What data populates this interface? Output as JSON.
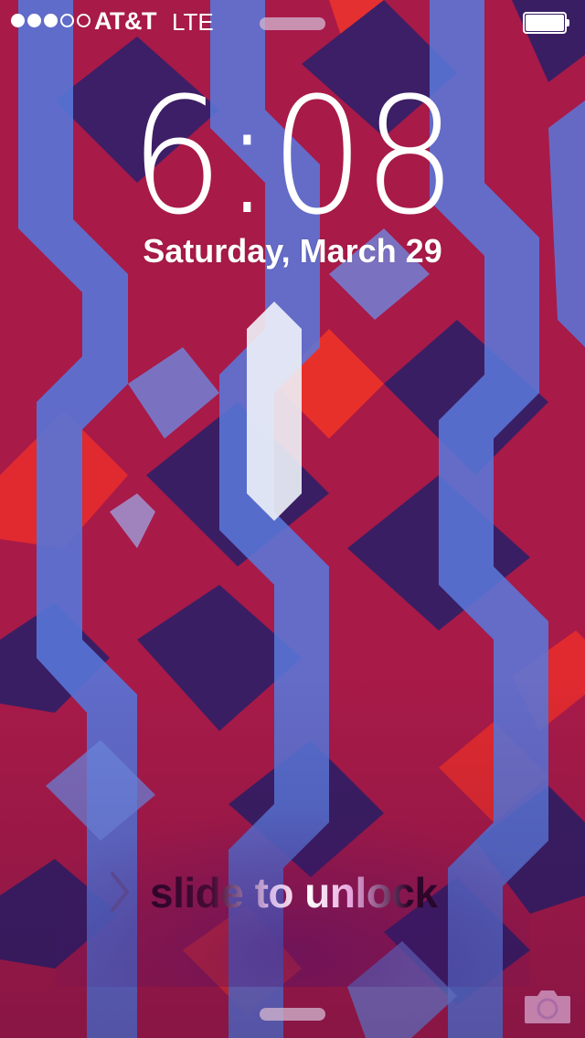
{
  "status_bar": {
    "signal_bars_filled": 3,
    "signal_bars_total": 5,
    "carrier": "AT&T",
    "network": "LTE",
    "battery_level": 1.0
  },
  "lock_screen": {
    "time": "6:08",
    "date": "Saturday, March 29",
    "slide_to_unlock": "slide to unlock"
  },
  "icons": {
    "chevron": "chevron-right-icon",
    "camera": "camera-icon",
    "battery": "battery-icon"
  },
  "colors": {
    "wallpaper_red": "#a81a48",
    "wallpaper_bright_red": "#e62a2a",
    "wallpaper_blue": "#5574d6",
    "wallpaper_navy": "#3a1f66",
    "text": "#ffffff"
  }
}
